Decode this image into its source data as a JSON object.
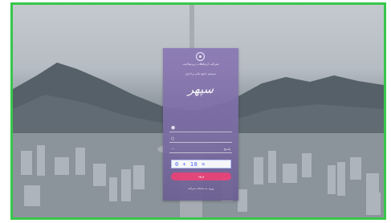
{
  "colors": {
    "frame_border": "#38c64a",
    "card": "#7d6ea6",
    "login_button": "#e83f78",
    "captcha_text": "#3f5bff"
  },
  "login": {
    "org_name": "شرکت ارتباطات زیرساخت",
    "system_title": "سیستم جامع مالی و اداری",
    "brand": "سپهر",
    "username": {
      "label": "",
      "icon": "user-icon"
    },
    "password": {
      "label": "",
      "icon": "lock-icon"
    },
    "captcha_answer": {
      "label": "پاسخ",
      "icon": "key-icon"
    },
    "captcha_text": "0 + 18 =",
    "login_button": "ورود",
    "external_link": "ورود به سامانه شرکت"
  }
}
